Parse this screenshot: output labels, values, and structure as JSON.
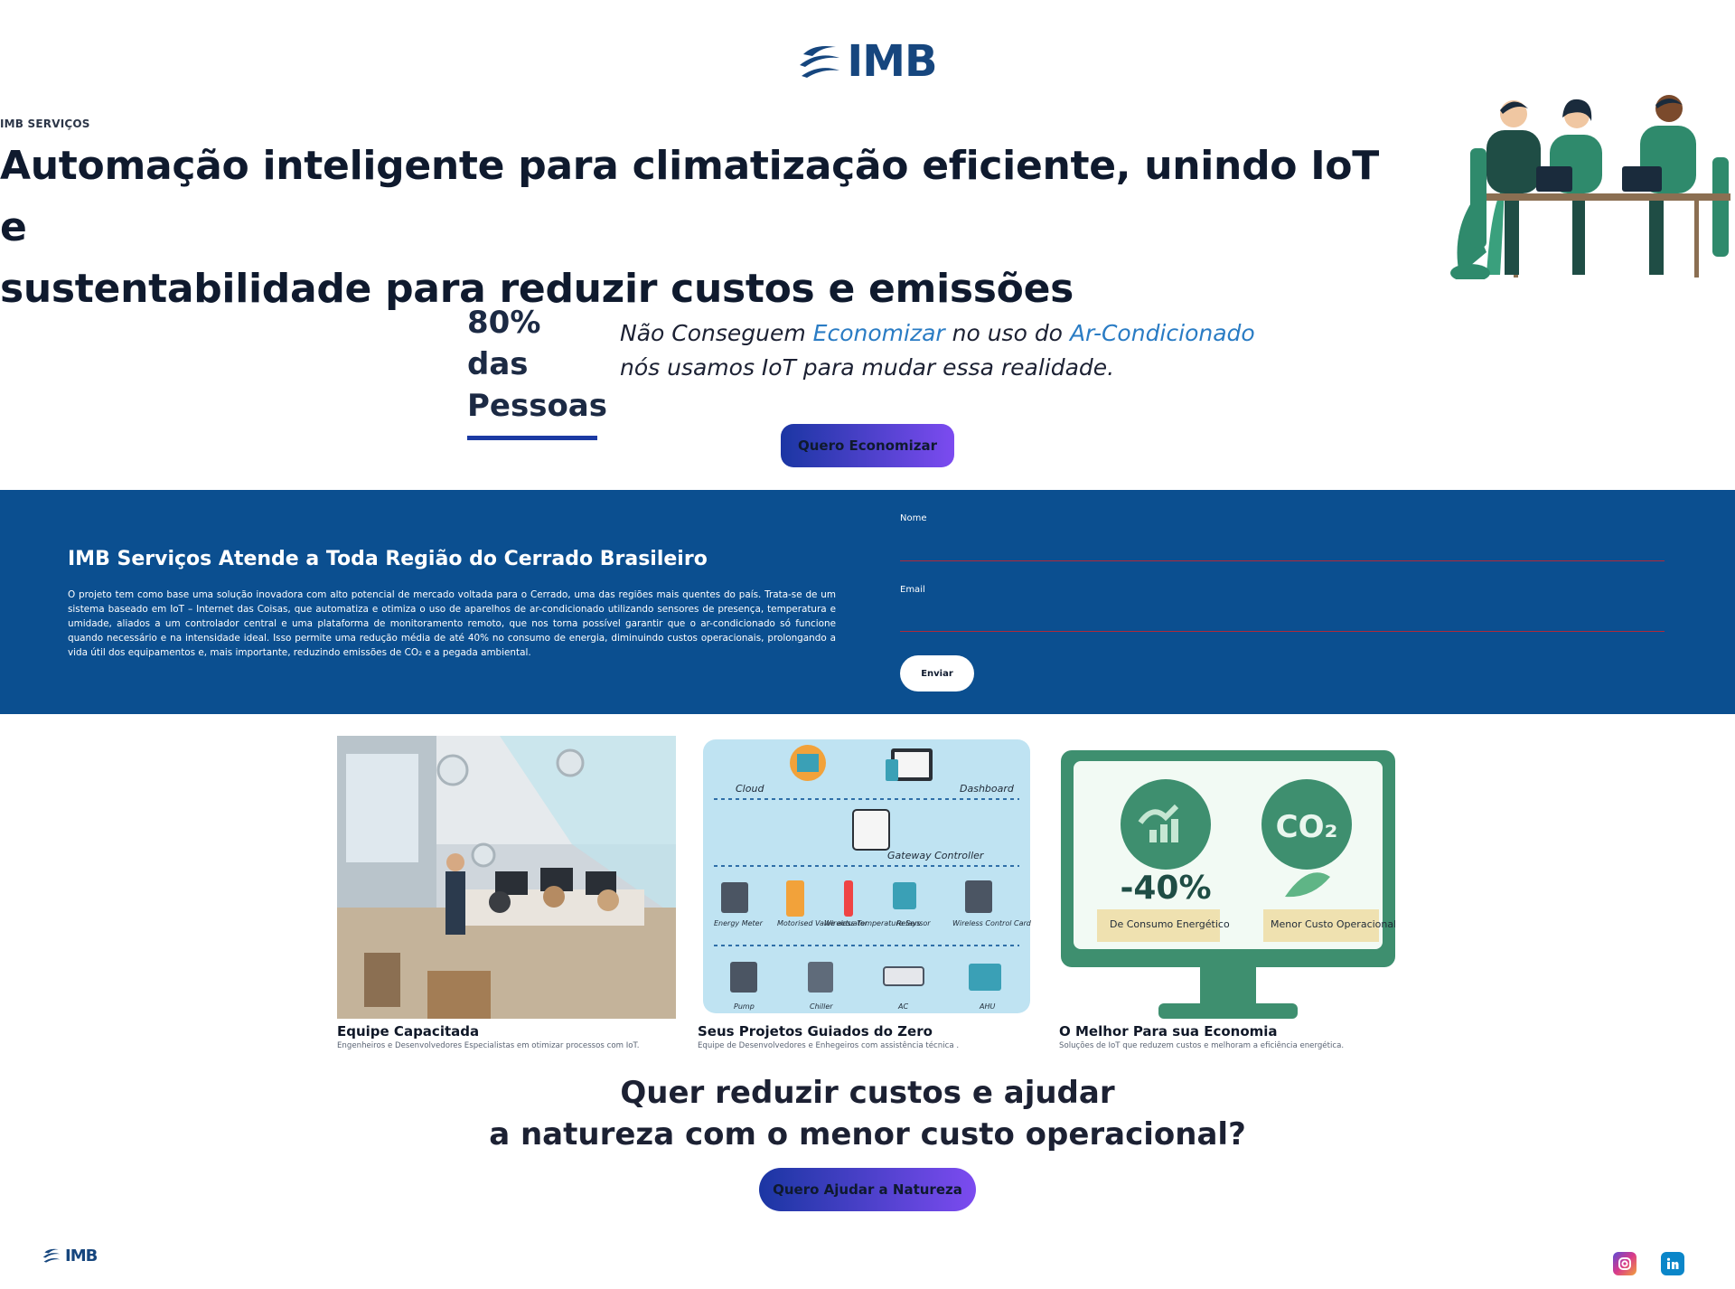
{
  "brand": {
    "name": "IMB"
  },
  "hero": {
    "eyebrow": "IMB SERVIÇOS",
    "title_line1": "Automação inteligente para climatização eficiente, unindo IoT e",
    "title_line2": "sustentabilidade para reduzir custos e emissões"
  },
  "stat": {
    "line1": "80% das",
    "line2": "Pessoas",
    "text_a": "Não Conseguem ",
    "text_b": "Economizar",
    "text_c": " no uso do ",
    "text_d": "Ar-Condicionado",
    "text_e": "nós usamos IoT para mudar essa realidade."
  },
  "buttons": {
    "economizar": "Quero Economizar",
    "enviar": "Enviar",
    "natureza": "Quero Ajudar a Natureza"
  },
  "band": {
    "title": "IMB Serviços Atende a Toda Região do Cerrado Brasileiro",
    "text": "O projeto tem como base uma solução inovadora com alto potencial de mercado voltada para o Cerrado, uma das regiões mais quentes do país. Trata-se de um sistema baseado em IoT – Internet das Coisas, que automatiza e otimiza o uso de aparelhos de ar-condicionado utilizando sensores de presença, temperatura e umidade, aliados a um controlador central e uma plataforma de monitoramento remoto, que nos torna possível garantir que o ar-condicionado só funcione quando necessário e na intensidade ideal. Isso permite uma redução média de até 40% no consumo de energia, diminuindo custos operacionais, prolongando a vida útil dos equipamentos e, mais importante, reduzindo emissões de CO₂ e a pegada ambiental."
  },
  "form": {
    "name_label": "Nome",
    "email_label": "Email",
    "name_value": "",
    "email_value": ""
  },
  "cards": [
    {
      "title": "Equipe Capacitada",
      "subtitle": "Engenheiros e Desenvolvedores Especialistas em otimizar processos com IoT."
    },
    {
      "title": "Seus Projetos Guiados do Zero",
      "subtitle": "Equipe de Desenvolvedores e Enhegeiros com assistência técnica ."
    },
    {
      "title": "O Melhor Para sua Economia",
      "subtitle": "Soluções de IoT que reduzem custos e melhoram a eficiência energética."
    }
  ],
  "diagram": {
    "cloud": "Cloud",
    "dashboard": "Dashboard",
    "gateway": "Gateway Controller",
    "devices": [
      "Energy Meter",
      "Motorised Valve actuator",
      "Wireless Temperature Sensor",
      "Relays",
      "Wireless Control Card"
    ],
    "equipment": [
      "Pump",
      "Chiller",
      "AC",
      "AHU"
    ]
  },
  "monitor": {
    "co2": "CO₂",
    "percent": "-40%",
    "label1": "De Consumo Energético",
    "label2": "Menor Custo Operacional"
  },
  "cta": {
    "line1": "Quer reduzir custos e ajudar",
    "line2": "a natureza com o menor custo operacional?"
  },
  "colors": {
    "band": "#0b4f90",
    "button_start": "#1b36a3",
    "button_end": "#7c4bf0",
    "logo": "#16467e",
    "monitor_green": "#3e8f6f"
  },
  "icons": [
    "instagram-icon",
    "linkedin-icon"
  ]
}
